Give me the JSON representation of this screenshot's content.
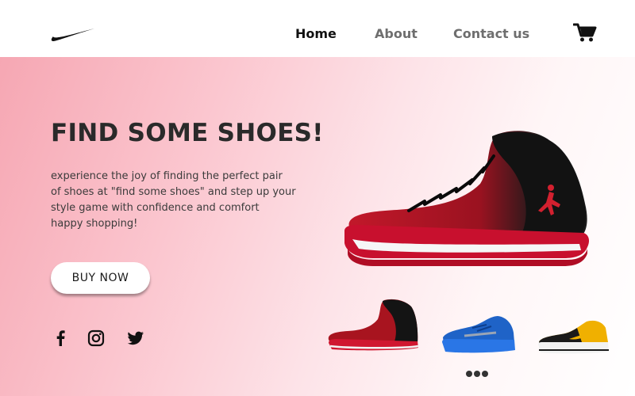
{
  "header": {
    "logo_icon": "nike-swoosh-icon",
    "nav": {
      "home": "Home",
      "about": "About",
      "contact": "Contact us"
    },
    "cart_icon": "shopping-cart-icon"
  },
  "hero": {
    "title": "FIND SOME SHOES!",
    "description_lines": [
      "experience the joy of finding the perfect pair",
      "of shoes at \"find some shoes\" and step up your",
      "style game with confidence and comfort",
      "happy shopping!"
    ],
    "buy_button": "BUY NOW",
    "social_icons": [
      "facebook-icon",
      "instagram-icon",
      "twitter-icon"
    ],
    "featured_shoe": "red-black-basketball-sneaker",
    "thumbnails": [
      "red-black-sneaker",
      "blue-running-shoe",
      "yellow-black-low-sneaker"
    ],
    "carousel_dots": 3
  },
  "colors": {
    "hero_gradient_start": "#f6a7b3",
    "hero_gradient_end": "#ffffff",
    "title": "#2a2a2a",
    "nav_active": "#111111",
    "nav_inactive": "#6e6e6e"
  }
}
